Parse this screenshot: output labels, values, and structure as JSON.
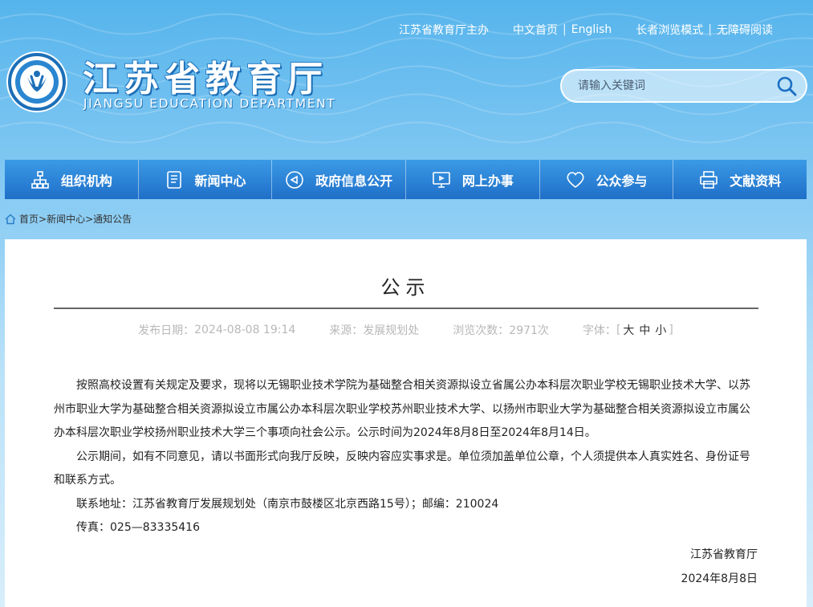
{
  "top_links": {
    "sponsor": "江苏省教育厅主办",
    "home_cn": "中文首页",
    "separator": "|",
    "english": "English",
    "elder_mode": "长者浏览模式",
    "accessible": "无障碍阅读"
  },
  "header": {
    "title_cn": "江苏省教育厅",
    "title_en": "JIANGSU EDUCATION DEPARTMENT"
  },
  "search": {
    "placeholder": "请输入关键词",
    "icon": "search-icon"
  },
  "nav": [
    {
      "label": "组织机构",
      "icon": "org-chart-icon"
    },
    {
      "label": "新闻中心",
      "icon": "document-icon"
    },
    {
      "label": "政府信息公开",
      "icon": "megaphone-icon"
    },
    {
      "label": "网上办事",
      "icon": "monitor-icon"
    },
    {
      "label": "公众参与",
      "icon": "heart-icon"
    },
    {
      "label": "文献资料",
      "icon": "printer-icon"
    }
  ],
  "breadcrumb": {
    "home": "首页",
    "sep": ">",
    "news": "新闻中心",
    "notice": "通知公告"
  },
  "article": {
    "title": "公示",
    "publish_label": "发布日期：",
    "publish_date": "2024-08-08 19:14",
    "source_label": "来源：",
    "source": "发展规划处",
    "views_label": "浏览次数：",
    "views": "2971次",
    "font_label": "字体：",
    "bracket_open": "[",
    "bracket_close": "]",
    "font_large": "大",
    "font_medium": "中",
    "font_small": "小",
    "paragraph1": "按照高校设置有关规定及要求，现将以无锡职业技术学院为基础整合相关资源拟设立省属公办本科层次职业学校无锡职业技术大学、以苏州市职业大学为基础整合相关资源拟设立市属公办本科层次职业学校苏州职业技术大学、以扬州市职业大学为基础整合相关资源拟设立市属公办本科层次职业学校扬州职业技术大学三个事项向社会公示。公示时间为2024年8月8日至2024年8月14日。",
    "paragraph2": "公示期间，如有不同意见，请以书面形式向我厅反映，反映内容应实事求是。单位须加盖单位公章，个人须提供本人真实姓名、身份证号和联系方式。",
    "paragraph3": "联系地址：江苏省教育厅发展规划处（南京市鼓楼区北京西路15号）；邮编：210024",
    "paragraph4": "传真：025—83335416",
    "signature_org": "江苏省教育厅",
    "signature_date": "2024年8月8日"
  },
  "colors": {
    "nav_top": "#3b9ae6",
    "nav_bottom": "#1f6fc8",
    "sky": "#56b4ec"
  }
}
